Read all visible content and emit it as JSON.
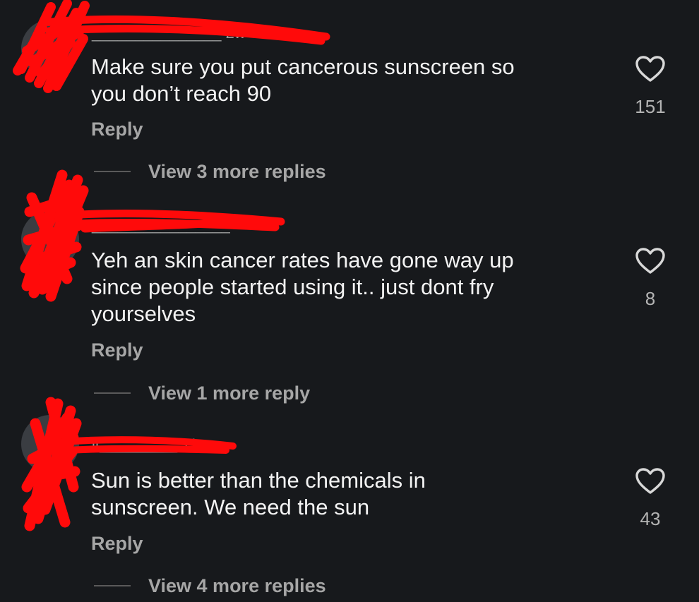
{
  "comments": [
    {
      "username": "_______________ 2w",
      "text": "Make sure you put cancerous sunscreen so\nyou don’t reach 90",
      "reply_label": "Reply",
      "view_more": "View 3 more replies",
      "like_count": "151",
      "like_icon": "heart-outline-icon"
    },
    {
      "username": "________________",
      "text": "Yeh an skin cancer rates have gone way up\nsince people started using it.. just dont fry\nyourselves",
      "reply_label": "Reply",
      "view_more": "View 1 more reply",
      "like_count": "8",
      "like_icon": "heart-outline-icon"
    },
    {
      "username": "it_________ 11w",
      "text": "Sun is better than the chemicals in\nsunscreen. We need the sun",
      "reply_label": "Reply",
      "view_more": "View 4 more replies",
      "like_count": "43",
      "like_icon": "heart-outline-icon"
    }
  ],
  "colors": {
    "background": "#17191c",
    "text": "#f3f3f3",
    "secondary_text": "#a6a6a6",
    "redaction": "#ff0a0a"
  }
}
